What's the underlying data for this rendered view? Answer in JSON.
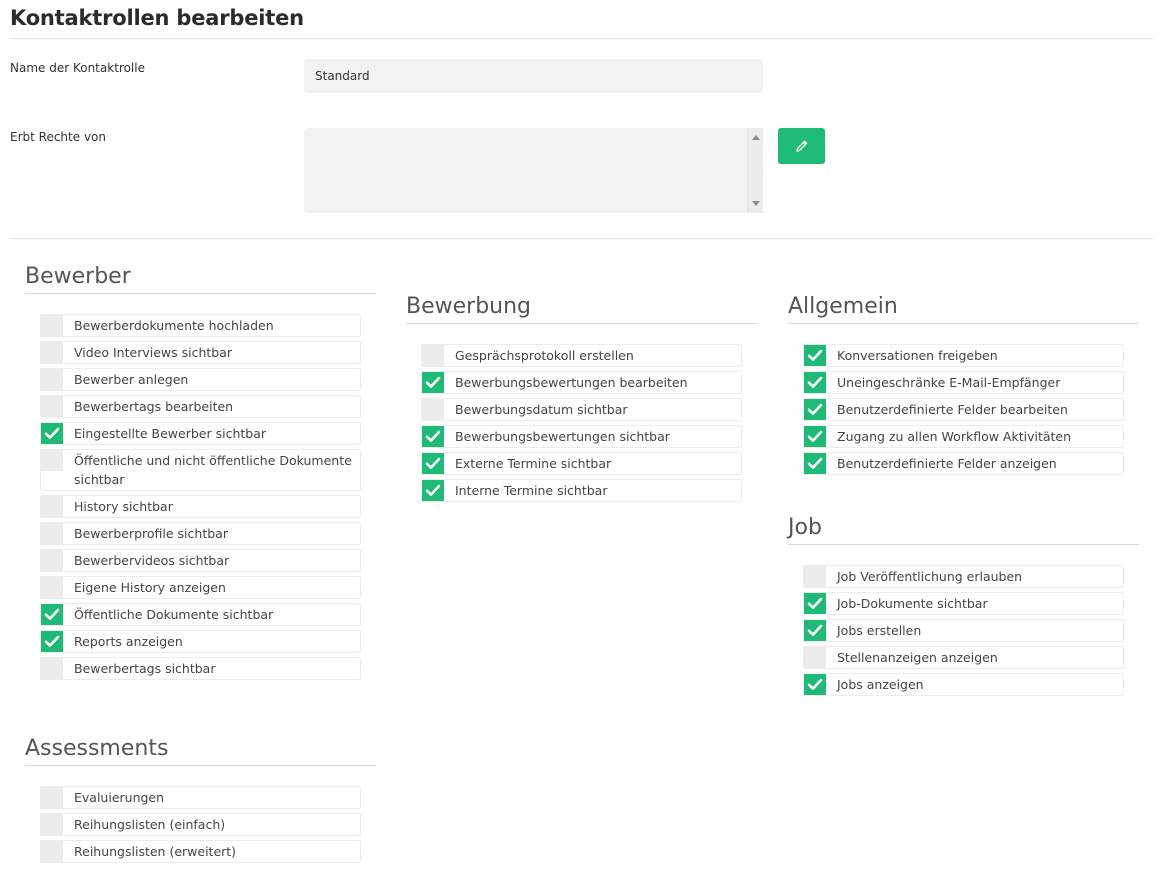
{
  "page": {
    "title": "Kontaktrollen bearbeiten"
  },
  "form": {
    "name_label": "Name der Kontaktrolle",
    "name_value": "Standard",
    "inherits_label": "Erbt Rechte von"
  },
  "colors": {
    "accent": "#1fba75",
    "checkbox_off": "#ececec"
  },
  "icons": {
    "edit": "pencil-icon",
    "check": "check-icon"
  },
  "sections": {
    "bewerber": {
      "title": "Bewerber",
      "items": [
        {
          "label": "Bewerberdokumente hochladen",
          "checked": false
        },
        {
          "label": "Video Interviews sichtbar",
          "checked": false
        },
        {
          "label": "Bewerber anlegen",
          "checked": false
        },
        {
          "label": "Bewerbertags bearbeiten",
          "checked": false
        },
        {
          "label": "Eingestellte Bewerber sichtbar",
          "checked": true
        },
        {
          "label": "Öffentliche und nicht öffentliche Dokumente sichtbar",
          "checked": false
        },
        {
          "label": "History sichtbar",
          "checked": false
        },
        {
          "label": "Bewerberprofile sichtbar",
          "checked": false
        },
        {
          "label": "Bewerbervideos sichtbar",
          "checked": false
        },
        {
          "label": "Eigene History anzeigen",
          "checked": false
        },
        {
          "label": "Öffentliche Dokumente sichtbar",
          "checked": true
        },
        {
          "label": "Reports anzeigen",
          "checked": true
        },
        {
          "label": "Bewerbertags sichtbar",
          "checked": false
        }
      ]
    },
    "assessments": {
      "title": "Assessments",
      "items": [
        {
          "label": "Evaluierungen",
          "checked": false
        },
        {
          "label": "Reihungslisten (einfach)",
          "checked": false
        },
        {
          "label": "Reihungslisten (erweitert)",
          "checked": false
        }
      ]
    },
    "bewerbung": {
      "title": "Bewerbung",
      "items": [
        {
          "label": "Gesprächsprotokoll erstellen",
          "checked": false
        },
        {
          "label": "Bewerbungsbewertungen bearbeiten",
          "checked": true
        },
        {
          "label": "Bewerbungsdatum sichtbar",
          "checked": false
        },
        {
          "label": "Bewerbungsbewertungen sichtbar",
          "checked": true
        },
        {
          "label": "Externe Termine sichtbar",
          "checked": true
        },
        {
          "label": "Interne Termine sichtbar",
          "checked": true
        }
      ]
    },
    "allgemein": {
      "title": "Allgemein",
      "items": [
        {
          "label": "Konversationen freigeben",
          "checked": true
        },
        {
          "label": "Uneingeschränke E-Mail-Empfänger",
          "checked": true
        },
        {
          "label": "Benutzerdefinierte Felder bearbeiten",
          "checked": true
        },
        {
          "label": "Zugang zu allen Workflow Aktivitäten",
          "checked": true
        },
        {
          "label": "Benutzerdefinierte Felder anzeigen",
          "checked": true
        }
      ]
    },
    "job": {
      "title": "Job",
      "items": [
        {
          "label": "Job Veröffentlichung erlauben",
          "checked": false
        },
        {
          "label": "Job-Dokumente sichtbar",
          "checked": true
        },
        {
          "label": "Jobs erstellen",
          "checked": true
        },
        {
          "label": "Stellenanzeigen anzeigen",
          "checked": false
        },
        {
          "label": "Jobs anzeigen",
          "checked": true
        }
      ]
    }
  }
}
